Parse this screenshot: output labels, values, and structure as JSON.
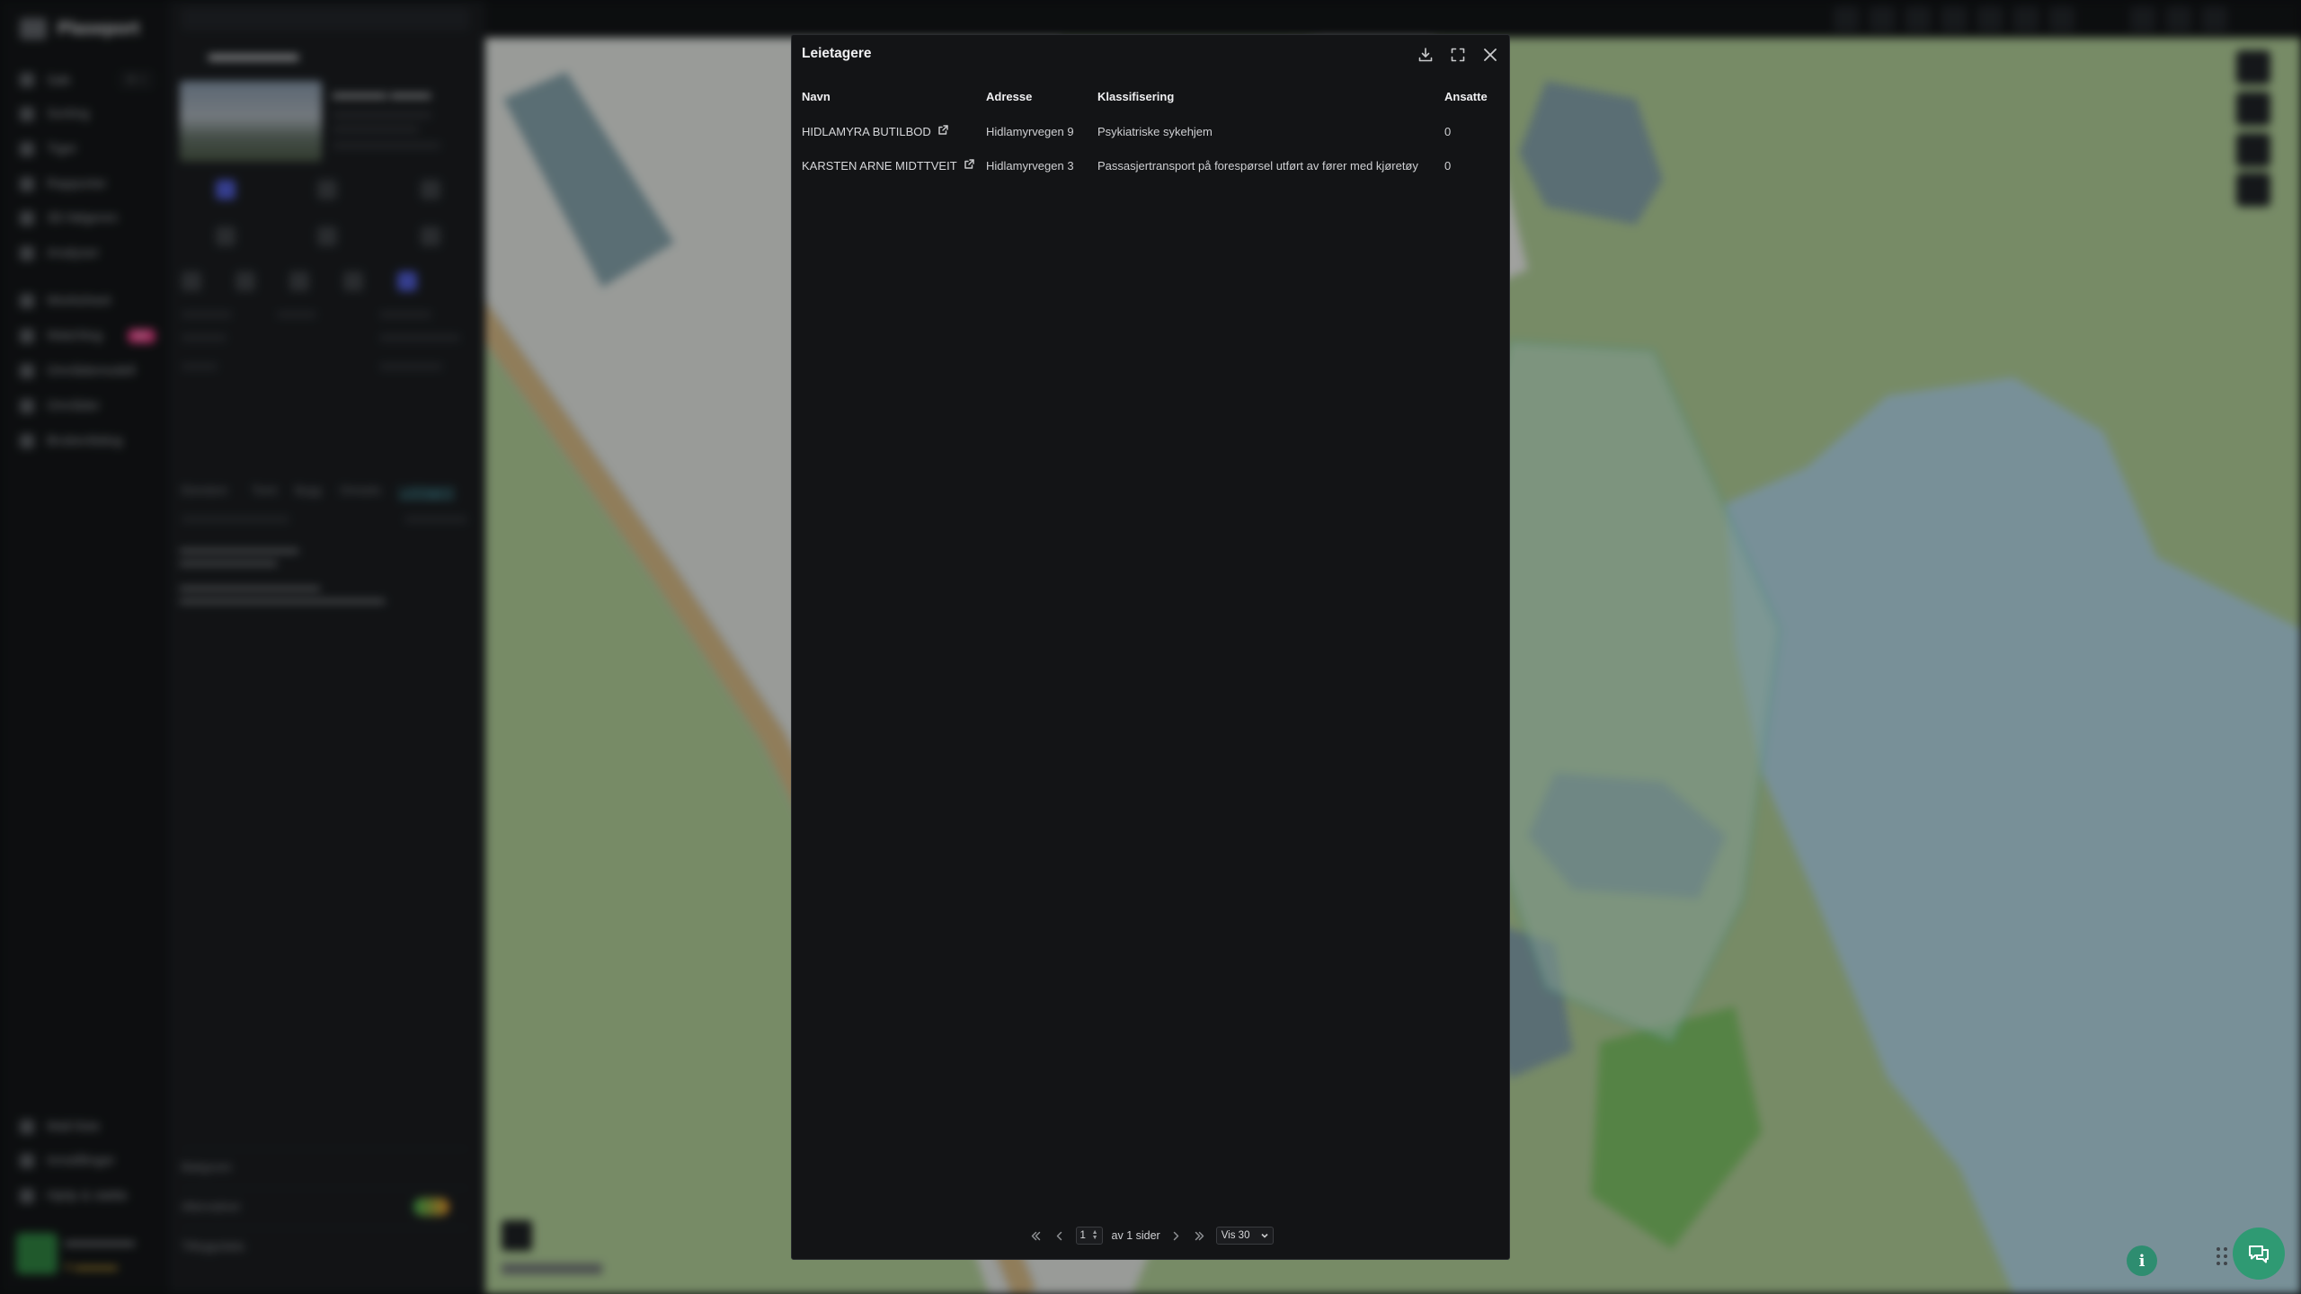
{
  "background": {
    "brand": "Plaseport",
    "nav": [
      {
        "label": "Søk",
        "kbd": "⌘ K"
      },
      {
        "label": "Sorting"
      },
      {
        "label": "Tiger"
      },
      {
        "label": "Rapporter"
      },
      {
        "label": "3D-følgeren"
      },
      {
        "label": "Analyser"
      },
      {
        "label": "Worksheet"
      },
      {
        "label": "Watchlog",
        "badge": "NY"
      },
      {
        "label": "Områdemodell"
      },
      {
        "label": "Områder"
      },
      {
        "label": "Brukerdialog"
      }
    ],
    "nav_bottom": [
      "Mail-liste",
      "Innstillinger",
      "Hjelp & støtte"
    ],
    "panel_tabs": [
      "Eiendom",
      "Tomt",
      "Bygg",
      "Omsetn.",
      "Leietagere"
    ],
    "panel_bottom": [
      "Bakgrunn",
      "Alternativer",
      "Tilleggsdata"
    ]
  },
  "modal": {
    "title": "Leietagere",
    "actions": [
      {
        "name": "download-icon",
        "label": "Last ned"
      },
      {
        "name": "fullscreen-icon",
        "label": "Fullskjerm"
      },
      {
        "name": "close-icon",
        "label": "Lukk"
      }
    ],
    "columns": [
      "Navn",
      "Adresse",
      "Klassifisering",
      "Ansatte"
    ],
    "rows": [
      {
        "name": "HIDLAMYRA BUTILBOD",
        "address": "Hidlamyrvegen 9",
        "classification": "Psykiatriske sykehjem",
        "employees": "0"
      },
      {
        "name": "KARSTEN ARNE MIDTTVEIT",
        "address": "Hidlamyrvegen 3",
        "classification": "Passasjertransport på forespørsel utført av fører med kjøretøy",
        "employees": "0"
      }
    ],
    "pagination": {
      "current_page": "1",
      "of_pages_text": "av 1 sider",
      "page_size_label": "Vis 30"
    }
  },
  "colors": {
    "modal_bg": "#131416",
    "map_green": "#a8c38f",
    "map_water": "#a9cbd6",
    "accent_teal": "#2f9a73"
  }
}
